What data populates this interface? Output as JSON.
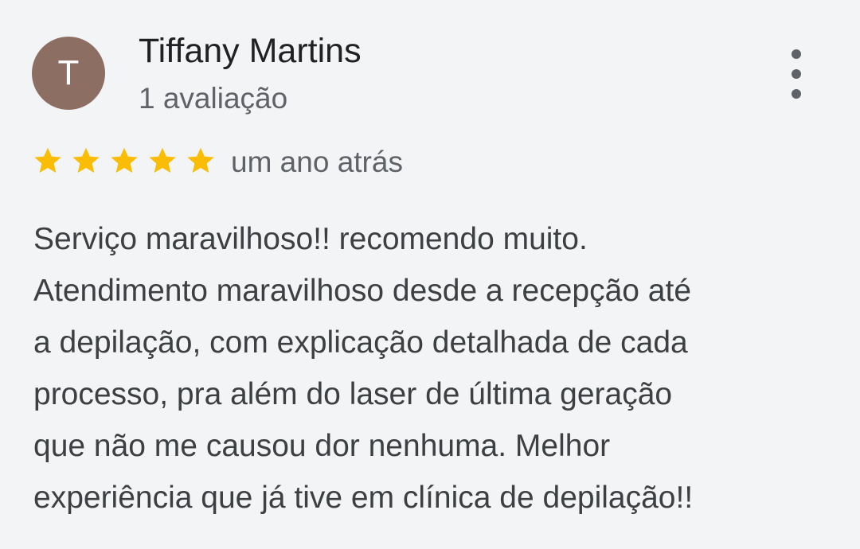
{
  "reviewer": {
    "initial": "T",
    "name": "Tiffany Martins",
    "review_count": "1 avaliação",
    "avatar_color": "#8d6e63"
  },
  "rating": {
    "stars": 5,
    "max": 5,
    "star_color": "#fbbc04",
    "time": "um ano atrás"
  },
  "review": {
    "lines": [
      "Serviço maravilhoso!! recomendo muito.",
      "Atendimento maravilhoso desde a recepção até",
      "a depilação, com explicação detalhada de cada",
      "processo, pra além do laser de última geração",
      "que não me causou dor nenhuma. Melhor",
      "experiência que já tive em clínica de depilação!!"
    ]
  },
  "menu": {
    "icon": "more-vert-icon"
  }
}
